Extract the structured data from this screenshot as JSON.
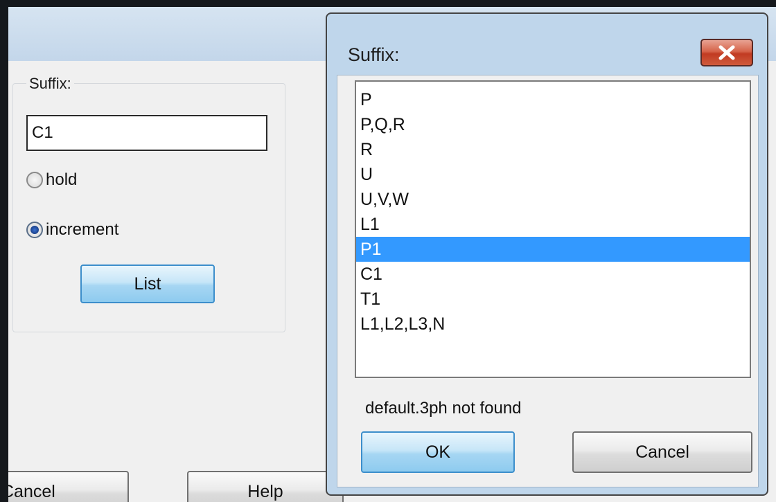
{
  "parent": {
    "group_label": "Suffix:",
    "input_value": "C1",
    "radio_hold": "hold",
    "radio_increment": "increment",
    "list_button": "List",
    "cancel_button": "Cancel",
    "help_button": "Help"
  },
  "modal": {
    "title": "Suffix:",
    "items": [
      "P",
      "P,Q,R",
      "R",
      "U",
      "U,V,W",
      "L1",
      "P1",
      "C1",
      "T1",
      "L1,L2,L3,N"
    ],
    "selected_item": "P1",
    "status": "default.3ph not found",
    "ok_button": "OK",
    "cancel_button": "Cancel"
  },
  "colors": {
    "selection": "#3399ff",
    "close_button": "#c13b22",
    "focus_button": "#a6d6f3"
  }
}
